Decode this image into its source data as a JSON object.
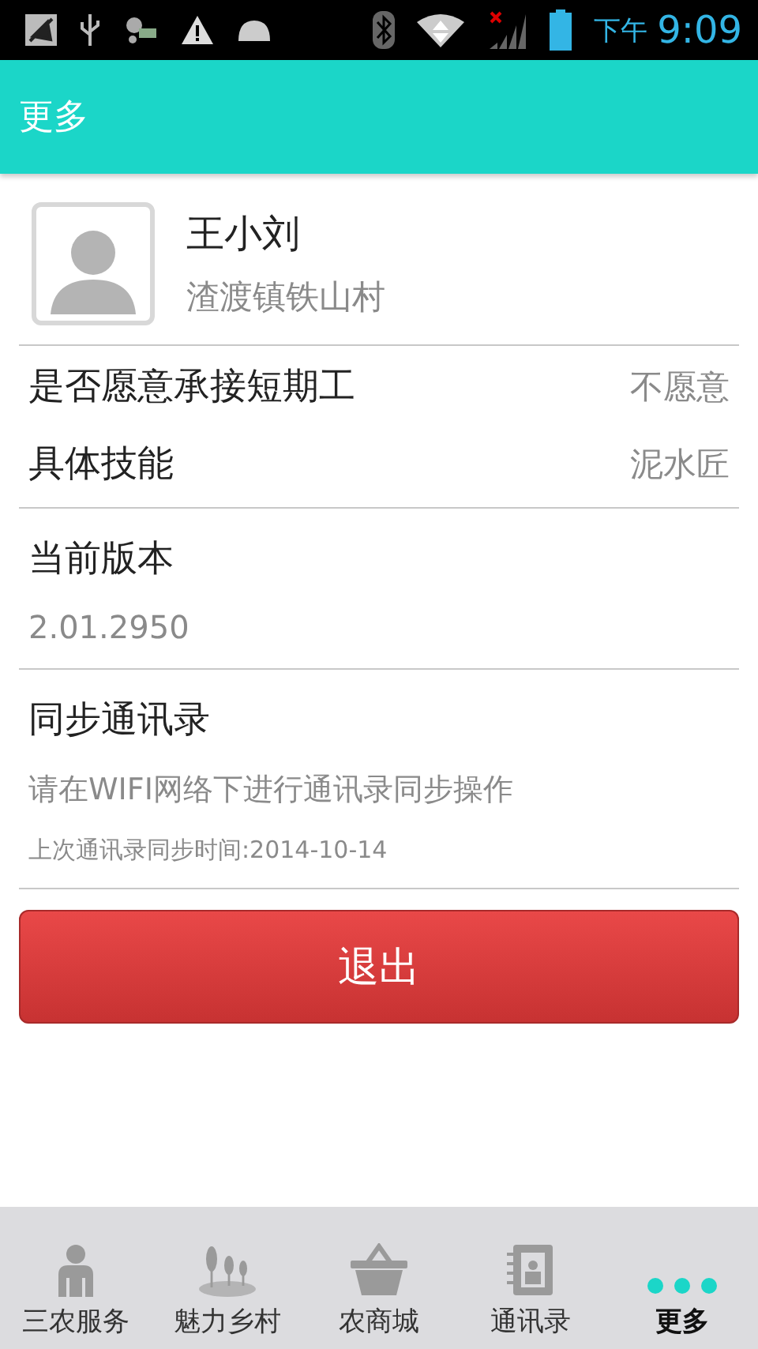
{
  "status_bar": {
    "period": "下午",
    "time": "9:09"
  },
  "header": {
    "title": "更多"
  },
  "profile": {
    "name": "王小刘",
    "location": "渣渡镇铁山村"
  },
  "settings": [
    {
      "label": "是否愿意承接短期工",
      "value": "不愿意"
    },
    {
      "label": "具体技能",
      "value": "泥水匠"
    }
  ],
  "version": {
    "title": "当前版本",
    "value": "2.01.2950"
  },
  "sync": {
    "title": "同步通讯录",
    "hint": "请在WIFI网络下进行通讯录同步操作",
    "last_sync": "上次通讯录同步时间:2014-10-14"
  },
  "logout_button": "退出",
  "nav": [
    {
      "label": "三农服务",
      "selected": false
    },
    {
      "label": "魅力乡村",
      "selected": false
    },
    {
      "label": "农商城",
      "selected": false
    },
    {
      "label": "通讯录",
      "selected": false
    },
    {
      "label": "更多",
      "selected": true
    }
  ]
}
